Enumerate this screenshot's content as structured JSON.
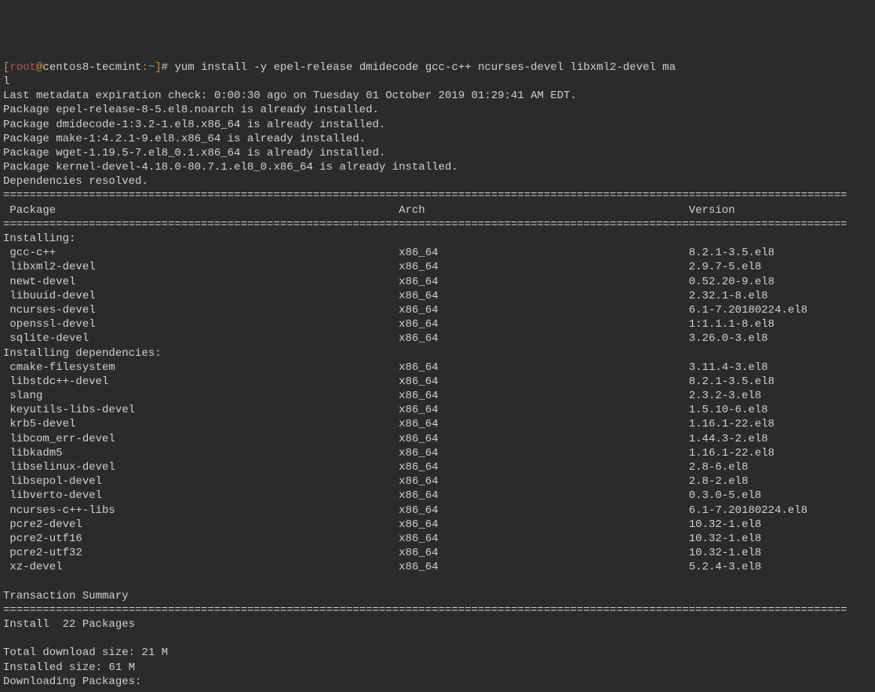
{
  "prompt": {
    "open": "[",
    "user": "root",
    "at": "@",
    "host": "centos8-tecmint",
    "colon": ":",
    "tilde": "~",
    "close": "]",
    "hash": "#"
  },
  "command": " yum install -y epel-release dmidecode gcc-c++ ncurses-devel libxml2-devel ma",
  "command_wrap": "l",
  "metadata_line": "Last metadata expiration check: 0:00:30 ago on Tuesday 01 October 2019 01:29:41 AM EDT.",
  "pkg_status": [
    "Package epel-release-8-5.el8.noarch is already installed.",
    "Package dmidecode-1:3.2-1.el8.x86_64 is already installed.",
    "Package make-1:4.2.1-9.el8.x86_64 is already installed.",
    "Package wget-1.19.5-7.el8_0.1.x86_64 is already installed.",
    "Package kernel-devel-4.18.0-80.7.1.el8_0.x86_64 is already installed."
  ],
  "deps_resolved": "Dependencies resolved.",
  "sep": "================================================================================================================================",
  "header": {
    "col1": " Package",
    "col2": "Arch",
    "col3": "Version"
  },
  "installing_label": "Installing:",
  "installing": [
    {
      "name": " gcc-c++",
      "arch": "x86_64",
      "version": "8.2.1-3.5.el8"
    },
    {
      "name": " libxml2-devel",
      "arch": "x86_64",
      "version": "2.9.7-5.el8"
    },
    {
      "name": " newt-devel",
      "arch": "x86_64",
      "version": "0.52.20-9.el8"
    },
    {
      "name": " libuuid-devel",
      "arch": "x86_64",
      "version": "2.32.1-8.el8"
    },
    {
      "name": " ncurses-devel",
      "arch": "x86_64",
      "version": "6.1-7.20180224.el8"
    },
    {
      "name": " openssl-devel",
      "arch": "x86_64",
      "version": "1:1.1.1-8.el8"
    },
    {
      "name": " sqlite-devel",
      "arch": "x86_64",
      "version": "3.26.0-3.el8"
    }
  ],
  "installing_deps_label": "Installing dependencies:",
  "installing_deps": [
    {
      "name": " cmake-filesystem",
      "arch": "x86_64",
      "version": "3.11.4-3.el8"
    },
    {
      "name": " libstdc++-devel",
      "arch": "x86_64",
      "version": "8.2.1-3.5.el8"
    },
    {
      "name": " slang",
      "arch": "x86_64",
      "version": "2.3.2-3.el8"
    },
    {
      "name": " keyutils-libs-devel",
      "arch": "x86_64",
      "version": "1.5.10-6.el8"
    },
    {
      "name": " krb5-devel",
      "arch": "x86_64",
      "version": "1.16.1-22.el8"
    },
    {
      "name": " libcom_err-devel",
      "arch": "x86_64",
      "version": "1.44.3-2.el8"
    },
    {
      "name": " libkadm5",
      "arch": "x86_64",
      "version": "1.16.1-22.el8"
    },
    {
      "name": " libselinux-devel",
      "arch": "x86_64",
      "version": "2.8-6.el8"
    },
    {
      "name": " libsepol-devel",
      "arch": "x86_64",
      "version": "2.8-2.el8"
    },
    {
      "name": " libverto-devel",
      "arch": "x86_64",
      "version": "0.3.0-5.el8"
    },
    {
      "name": " ncurses-c++-libs",
      "arch": "x86_64",
      "version": "6.1-7.20180224.el8"
    },
    {
      "name": " pcre2-devel",
      "arch": "x86_64",
      "version": "10.32-1.el8"
    },
    {
      "name": " pcre2-utf16",
      "arch": "x86_64",
      "version": "10.32-1.el8"
    },
    {
      "name": " pcre2-utf32",
      "arch": "x86_64",
      "version": "10.32-1.el8"
    },
    {
      "name": " xz-devel",
      "arch": "x86_64",
      "version": "5.2.4-3.el8"
    }
  ],
  "transaction_summary": "Transaction Summary",
  "install_count": "Install  22 Packages",
  "download_size": "Total download size: 21 M",
  "installed_size": "Installed size: 61 M",
  "downloading": "Downloading Packages:"
}
